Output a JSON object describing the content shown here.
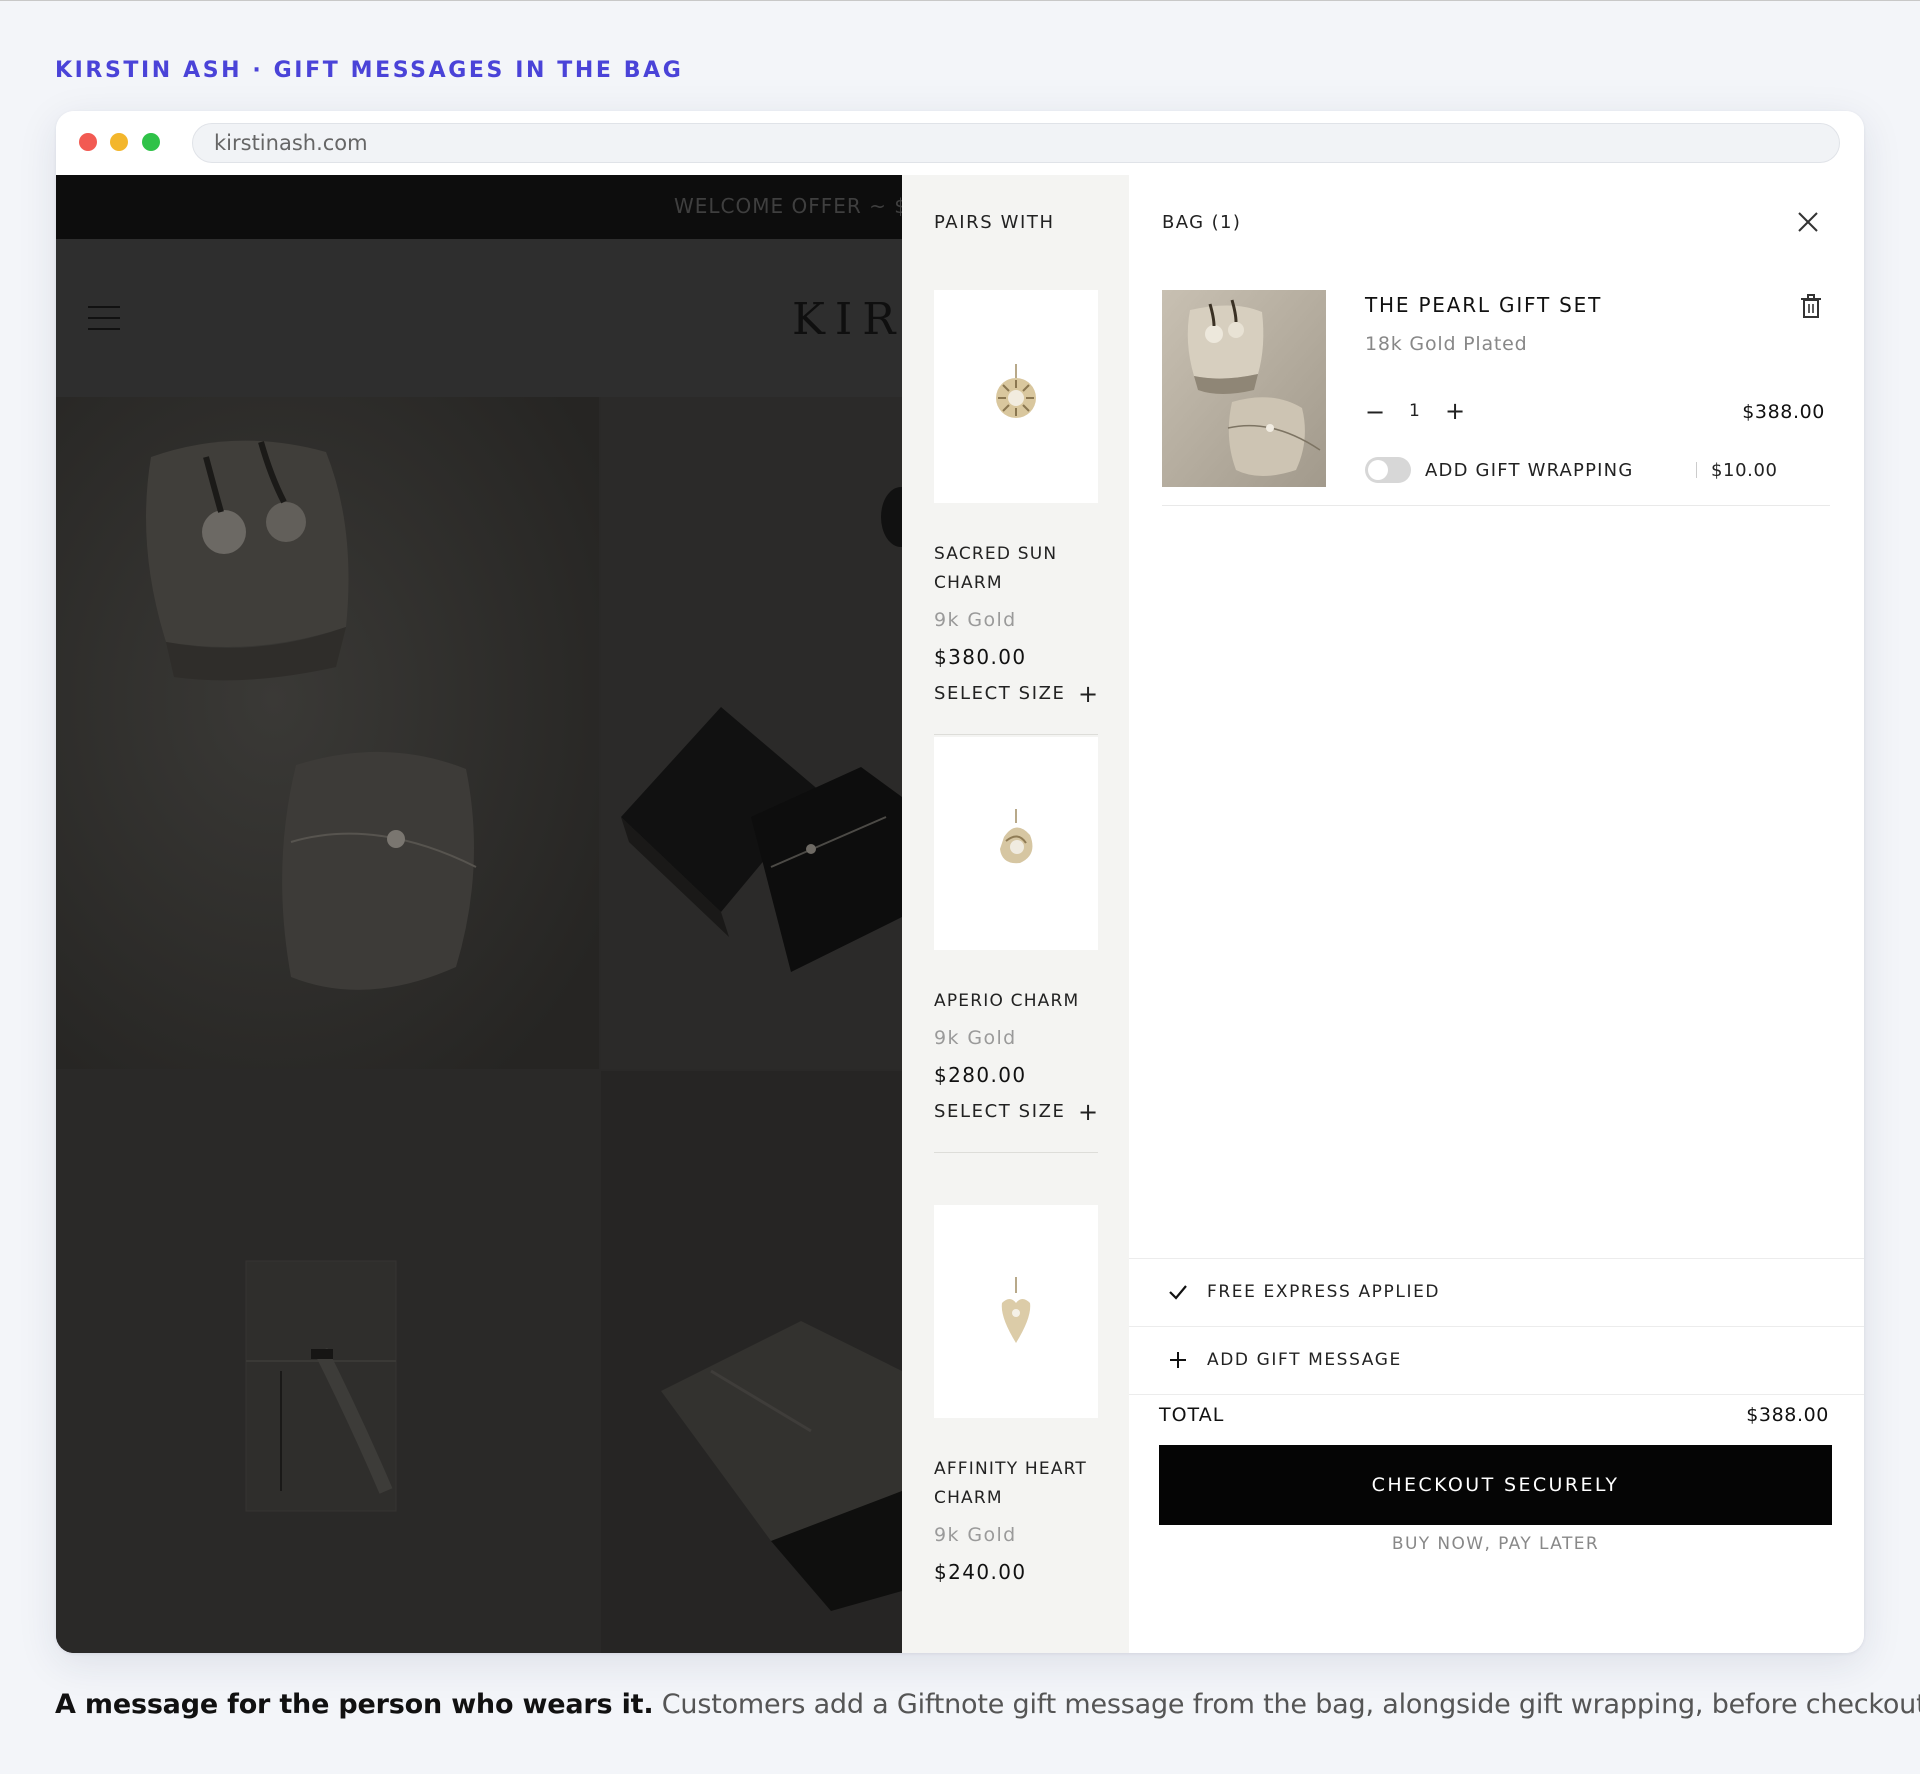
{
  "eyebrow": "KIRSTIN ASH · GIFT MESSAGES IN THE BAG",
  "browser": {
    "url": "kirstinash.com"
  },
  "site": {
    "promo_text": "WELCOME OFFER ~ $",
    "logo_text": "KIRS"
  },
  "pairs_with": {
    "title": "PAIRS WITH",
    "items": [
      {
        "name_line1": "SACRED SUN",
        "name_line2": "CHARM",
        "material": "9k Gold",
        "price": "$380.00",
        "size_label": "SELECT SIZE",
        "icon": "plus-icon"
      },
      {
        "name_line1": "APERIO CHARM",
        "name_line2": "",
        "material": "9k Gold",
        "price": "$280.00",
        "size_label": "SELECT SIZE",
        "icon": "plus-icon"
      },
      {
        "name_line1": "AFFINITY HEART",
        "name_line2": "CHARM",
        "material": "9k Gold",
        "price": "$240.00"
      }
    ]
  },
  "bag": {
    "title": "BAG (1)",
    "item": {
      "name": "THE PEARL GIFT SET",
      "variant": "18k Gold Plated",
      "qty_minus": "−",
      "quantity": "1",
      "qty_plus": "+",
      "price": "$388.00",
      "gift_wrap_label": "ADD GIFT WRAPPING",
      "gift_wrap_price": "$10.00",
      "gift_wrap_on": false
    },
    "free_express": "FREE EXPRESS APPLIED",
    "gift_message": "ADD GIFT MESSAGE",
    "total_label": "TOTAL",
    "total_value": "$388.00",
    "checkout_label": "CHECKOUT SECURELY",
    "bnpl_label": "BUY NOW, PAY LATER"
  },
  "caption": {
    "bold": "A message for the person who wears it.",
    "rest": " Customers add a Giftnote gift message from the bag, alongside gift wrapping, before checkout."
  },
  "colors": {
    "eyebrow": "#4a43d8",
    "checkout_bg": "#050505",
    "overlay_site": "#2a2928"
  }
}
